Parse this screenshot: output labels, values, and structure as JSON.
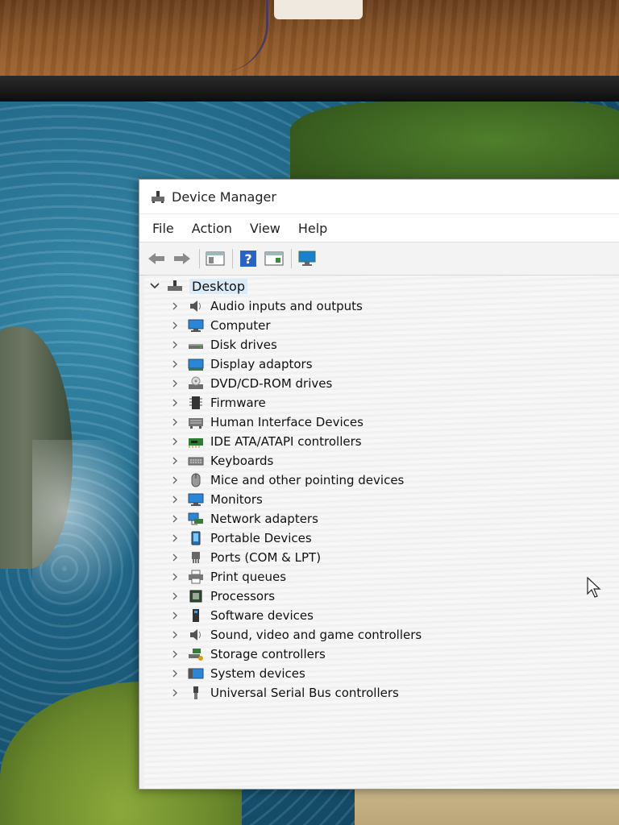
{
  "window": {
    "title": "Device Manager"
  },
  "menu": [
    "File",
    "Action",
    "View",
    "Help"
  ],
  "toolbar": {
    "buttons": [
      "back-icon",
      "forward-icon",
      "properties-icon",
      "help-icon",
      "view-icon",
      "monitor-scan-icon"
    ]
  },
  "tree": {
    "root": "Desktop",
    "items": [
      {
        "label": "Audio inputs and outputs",
        "icon": "speaker-icon"
      },
      {
        "label": "Computer",
        "icon": "computer-icon"
      },
      {
        "label": "Disk drives",
        "icon": "disk-drive-icon"
      },
      {
        "label": "Display adaptors",
        "icon": "display-adapter-icon"
      },
      {
        "label": "DVD/CD-ROM drives",
        "icon": "dvd-drive-icon"
      },
      {
        "label": "Firmware",
        "icon": "firmware-icon"
      },
      {
        "label": "Human Interface Devices",
        "icon": "hid-icon"
      },
      {
        "label": "IDE ATA/ATAPI controllers",
        "icon": "ide-controller-icon"
      },
      {
        "label": "Keyboards",
        "icon": "keyboard-icon"
      },
      {
        "label": "Mice and other pointing devices",
        "icon": "mouse-icon"
      },
      {
        "label": "Monitors",
        "icon": "monitor-icon"
      },
      {
        "label": "Network adapters",
        "icon": "network-adapter-icon"
      },
      {
        "label": "Portable Devices",
        "icon": "portable-device-icon"
      },
      {
        "label": "Ports (COM & LPT)",
        "icon": "port-icon"
      },
      {
        "label": "Print queues",
        "icon": "printer-icon"
      },
      {
        "label": "Processors",
        "icon": "processor-icon"
      },
      {
        "label": "Software devices",
        "icon": "software-device-icon"
      },
      {
        "label": "Sound, video and game controllers",
        "icon": "sound-controller-icon"
      },
      {
        "label": "Storage controllers",
        "icon": "storage-controller-icon"
      },
      {
        "label": "System devices",
        "icon": "system-device-icon"
      },
      {
        "label": "Universal Serial Bus controllers",
        "icon": "usb-icon"
      }
    ]
  },
  "colors": {
    "selection": "#dcebf8",
    "accent": "#2a7fd4"
  }
}
